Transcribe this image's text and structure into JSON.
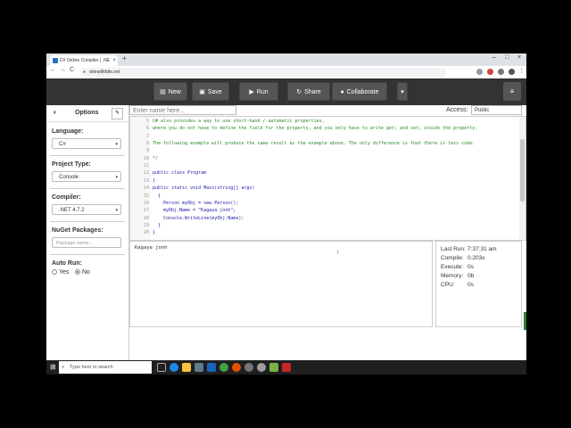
{
  "browser": {
    "tab_title": "C# Online Compiler | .NET Fiddle",
    "tab_close": "×",
    "new_tab": "+",
    "min": "–",
    "max": "□",
    "close": "×",
    "url": "dotnetfiddle.net",
    "back": "←",
    "forward": "→",
    "reload": "C"
  },
  "toolbar": {
    "new_label": "New",
    "save_label": "Save",
    "run_label": "Run",
    "share_label": "Share",
    "collaborate_label": "Collaborate",
    "more": "▾",
    "menu": "≡"
  },
  "options": {
    "title": "Options",
    "back": "‹",
    "pin": "✎",
    "language_label": "Language:",
    "language_value": "C#",
    "project_type_label": "Project Type:",
    "project_type_value": "Console",
    "compiler_label": "Compiler:",
    "compiler_value": ".NET 4.7.2",
    "nuget_label": "NuGet Packages:",
    "nuget_placeholder": "Package name...",
    "autorun_label": "Auto Run:",
    "autorun_yes": "Yes",
    "autorun_no": "No",
    "caret": "▾"
  },
  "editor_header": {
    "name_placeholder": "Enter name here...",
    "access_label": "Access:",
    "access_value": "Public"
  },
  "code_lines": [
    {
      "n": "5",
      "text": "C# also provides a way to use short-hand / automatic properties,",
      "kind": "comment"
    },
    {
      "n": "6",
      "text": "where you do not have to define the field for the property, and you only have to write get; and set; inside the property.",
      "kind": "comment"
    },
    {
      "n": "7",
      "text": "",
      "kind": "comment"
    },
    {
      "n": "8",
      "text": "The following example will produce the same result as the example above. The only difference is that there is less code:",
      "kind": "comment"
    },
    {
      "n": "9",
      "text": "",
      "kind": "comment"
    },
    {
      "n": "10",
      "text": "*/",
      "kind": "comment"
    },
    {
      "n": "11",
      "text": "",
      "kind": "code"
    },
    {
      "n": "12",
      "text": "public class Program",
      "kind": "code"
    },
    {
      "n": "13",
      "text": "{",
      "kind": "code"
    },
    {
      "n": "14",
      "text": "public static void Main(string[] args)",
      "kind": "code"
    },
    {
      "n": "15",
      "text": "  {",
      "kind": "code"
    },
    {
      "n": "16",
      "text": "    Person myObj = new Person();",
      "kind": "code"
    },
    {
      "n": "17",
      "text": "    myObj.Name = \"Kagaya jonh\";",
      "kind": "code"
    },
    {
      "n": "18",
      "text": "    Console.WriteLine(myObj.Name);",
      "kind": "code"
    },
    {
      "n": "19",
      "text": "  }",
      "kind": "code"
    },
    {
      "n": "20",
      "text": "}",
      "kind": "code"
    }
  ],
  "output": {
    "text": "Kagaya jonh"
  },
  "stats": {
    "last_run_label": "Last Run:",
    "last_run_value": "7:37:31 am",
    "compile_label": "Compile:",
    "compile_value": "0.203s",
    "execute_label": "Execute:",
    "execute_value": "0s",
    "memory_label": "Memory:",
    "memory_value": "0b",
    "cpu_label": "CPU:",
    "cpu_value": "0s"
  },
  "taskbar": {
    "start": "⊞",
    "search_placeholder": "Type here to search",
    "apps": [
      "task-view",
      "edge",
      "file-explorer",
      "store",
      "mail",
      "chrome",
      "media",
      "clock",
      "app-green",
      "app-red"
    ]
  },
  "colors": {
    "toolbar_bg": "#333333",
    "button_bg": "#555555",
    "comment": "#2b8a2b",
    "code": "#1a1aa6"
  }
}
